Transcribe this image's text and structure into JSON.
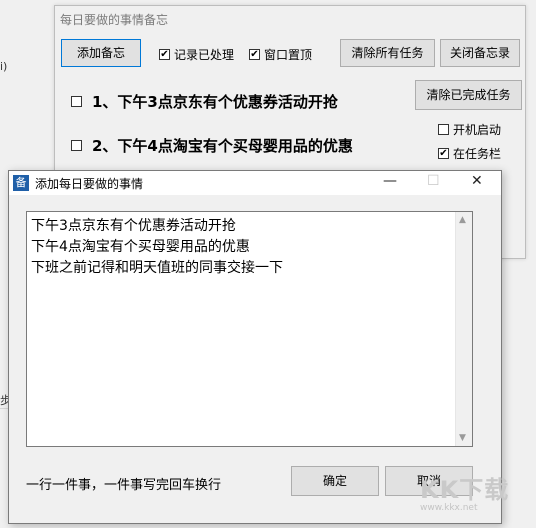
{
  "background": {
    "left_fragment_top": "i)",
    "left_fragment_bottom": "步"
  },
  "main_window": {
    "title": "每日要做的事情备忘",
    "buttons": {
      "add_memo": "添加备忘",
      "clear_all": "清除所有任务",
      "close_memo": "关闭备忘录",
      "clear_done": "清除已完成任务"
    },
    "checkboxes": [
      {
        "label": "记录已处理",
        "checked": true
      },
      {
        "label": "窗口置顶",
        "checked": true
      },
      {
        "label": "开机启动",
        "checked": false
      },
      {
        "label": "在任务栏",
        "checked": true
      }
    ],
    "tasks": [
      {
        "text": "1、下午3点京东有个优惠券活动开抢",
        "checked": false
      },
      {
        "text": "2、下午4点淘宝有个买母婴用品的优惠",
        "checked": false
      }
    ]
  },
  "dialog": {
    "icon_glyph": "备",
    "title": "添加每日要做的事情",
    "controls": {
      "minimize": "—",
      "maximize": "☐",
      "close": "✕"
    },
    "textarea_lines": [
      "下午3点京东有个优惠券活动开抢",
      "下午4点淘宝有个买母婴用品的优惠",
      "下班之前记得和明天值班的同事交接一下"
    ],
    "hint": "一行一件事，一件事写完回车换行",
    "ok_label": "确定",
    "cancel_label": "取消"
  },
  "watermark": {
    "brand": "KK下载",
    "url": "www.kkx.net"
  }
}
